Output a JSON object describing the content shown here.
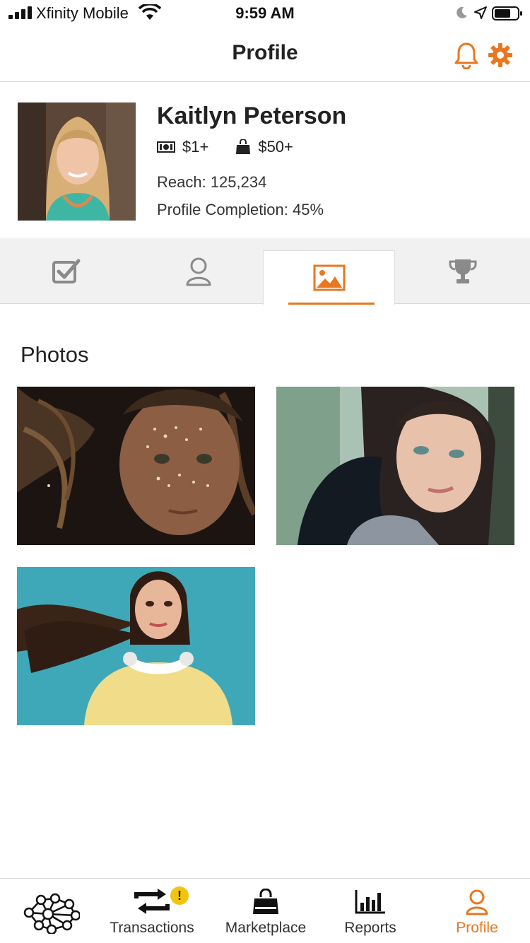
{
  "status_bar": {
    "carrier": "Xfinity Mobile",
    "time": "9:59 AM"
  },
  "nav": {
    "title": "Profile",
    "icons": [
      "bell-icon",
      "gear-icon"
    ]
  },
  "profile": {
    "name": "Kaitlyn Peterson",
    "cash_rate": "$1+",
    "purchase_rate": "$50+",
    "reach": "Reach: 125,234",
    "completion": "Profile Completion: 45%"
  },
  "tabs": [
    {
      "icon": "checkbox-icon",
      "active": false
    },
    {
      "icon": "user-icon",
      "active": false
    },
    {
      "icon": "image-icon",
      "active": true
    },
    {
      "icon": "trophy-icon",
      "active": false
    }
  ],
  "photos_section": {
    "title": "Photos",
    "photos": [
      {
        "subject": "child with glitter freckles"
      },
      {
        "subject": "woman in fur coat"
      },
      {
        "subject": "woman with headphones"
      }
    ]
  },
  "tab_bar": {
    "items": [
      {
        "label": "",
        "icon": "network-icon"
      },
      {
        "label": "Transactions",
        "icon": "transactions-icon",
        "badge": "!"
      },
      {
        "label": "Marketplace",
        "icon": "shopping-bag-icon"
      },
      {
        "label": "Reports",
        "icon": "bar-chart-icon"
      },
      {
        "label": "Profile",
        "icon": "user-icon",
        "active": true
      }
    ]
  },
  "colors": {
    "accent": "#e8771f",
    "badge": "#f1c40f",
    "tab_background": "#f1f1f1",
    "divider": "#d9d9d9"
  }
}
